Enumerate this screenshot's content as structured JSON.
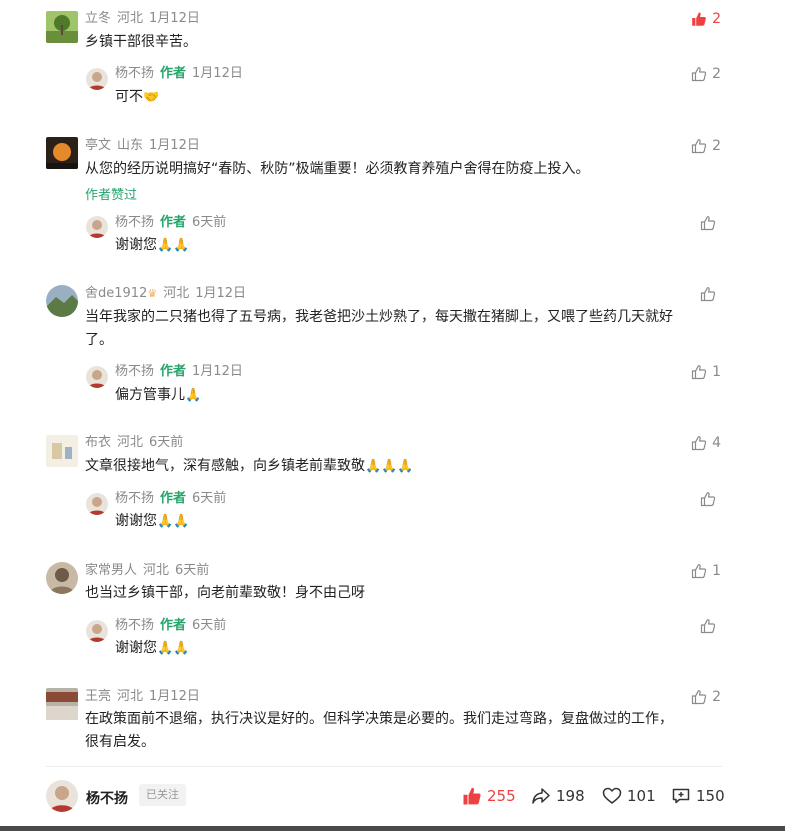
{
  "comments": [
    {
      "user": "立冬",
      "region": "河北",
      "time": "1月12日",
      "text": "乡镇干部很辛苦。",
      "likes": "2",
      "liked": true,
      "reply": {
        "user": "杨不扬",
        "tag": "作者",
        "time": "1月12日",
        "text": "可不",
        "emoji": "🤝",
        "likes": "2"
      }
    },
    {
      "user": "亭文",
      "region": "山东",
      "time": "1月12日",
      "text": "从您的经历说明搞好“春防、秋防”极端重要！必须教育养殖户舍得在防疫上投入。",
      "liked_by_author": "作者赞过",
      "likes": "2",
      "reply": {
        "user": "杨不扬",
        "tag": "作者",
        "time": "6天前",
        "text": "谢谢您",
        "emoji": "🙏🙏",
        "likes": ""
      }
    },
    {
      "user": "舍de1912",
      "user_badge": "♛",
      "region": "河北",
      "time": "1月12日",
      "text_line1": "当年我家的二只猪也得了五号病，我老爸把沙土炒熟了，每天撒在猪脚上，又喂了些药几天就好",
      "text_line2": "了。",
      "likes": "",
      "reply": {
        "user": "杨不扬",
        "tag": "作者",
        "time": "1月12日",
        "text": "偏方管事儿",
        "emoji": "🙏",
        "likes": "1"
      }
    },
    {
      "user": "布衣",
      "region": "河北",
      "time": "6天前",
      "text": "文章很接地气，深有感触，向乡镇老前辈致敬",
      "emoji": "🙏🙏🙏",
      "likes": "4",
      "reply": {
        "user": "杨不扬",
        "tag": "作者",
        "time": "6天前",
        "text": "谢谢您",
        "emoji": "🙏🙏",
        "likes": ""
      }
    },
    {
      "user": "家常男人",
      "region": "河北",
      "time": "6天前",
      "text": "也当过乡镇干部，向老前辈致敬！身不由己呀",
      "likes": "1",
      "reply": {
        "user": "杨不扬",
        "tag": "作者",
        "time": "6天前",
        "text": "谢谢您",
        "emoji": "🙏🙏",
        "likes": ""
      }
    },
    {
      "user": "王亮",
      "region": "河北",
      "time": "1月12日",
      "text_line1": "在政策面前不退缩，执行决议是好的。但科学决策是必要的。我们走过弯路，复盘做过的工作，",
      "text_line2": "很有启发。",
      "likes": "2"
    }
  ],
  "footer": {
    "author": "杨不扬",
    "follow_label": "已关注",
    "likes": "255",
    "shares": "198",
    "favorites": "101",
    "comments": "150"
  },
  "colors": {
    "liked_red": "#f04142",
    "author_green": "#26a46b",
    "meta_gray": "#8a8a8a"
  },
  "icons": [
    "thumb-up-icon",
    "share-icon",
    "heart-icon",
    "comment-add-icon"
  ]
}
